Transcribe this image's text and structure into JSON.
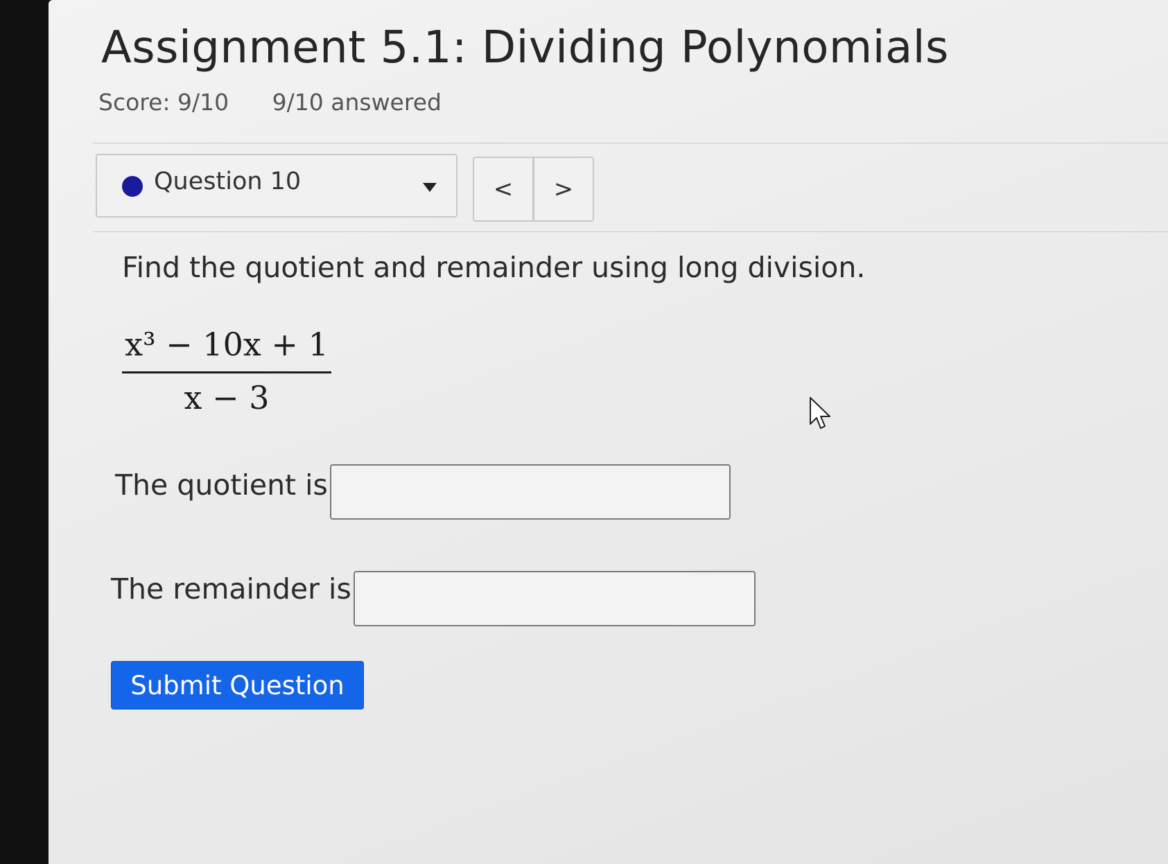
{
  "assignment": {
    "title": "Assignment 5.1: Dividing Polynomials",
    "score": "Score: 9/10",
    "answered": "9/10 answered"
  },
  "question_nav": {
    "selected_question": "Question 10",
    "status_color": "#1a1a9c",
    "prev_label": "<",
    "next_label": ">"
  },
  "question": {
    "prompt": "Find the quotient and remainder using long division.",
    "expression": {
      "numerator": "x³ − 10x + 1",
      "denominator": "x − 3"
    },
    "fields": [
      {
        "label": "The quotient is",
        "value": ""
      },
      {
        "label": "The remainder is",
        "value": ""
      }
    ],
    "submit_label": "Submit Question"
  },
  "colors": {
    "submit_button": "#1565e8"
  }
}
